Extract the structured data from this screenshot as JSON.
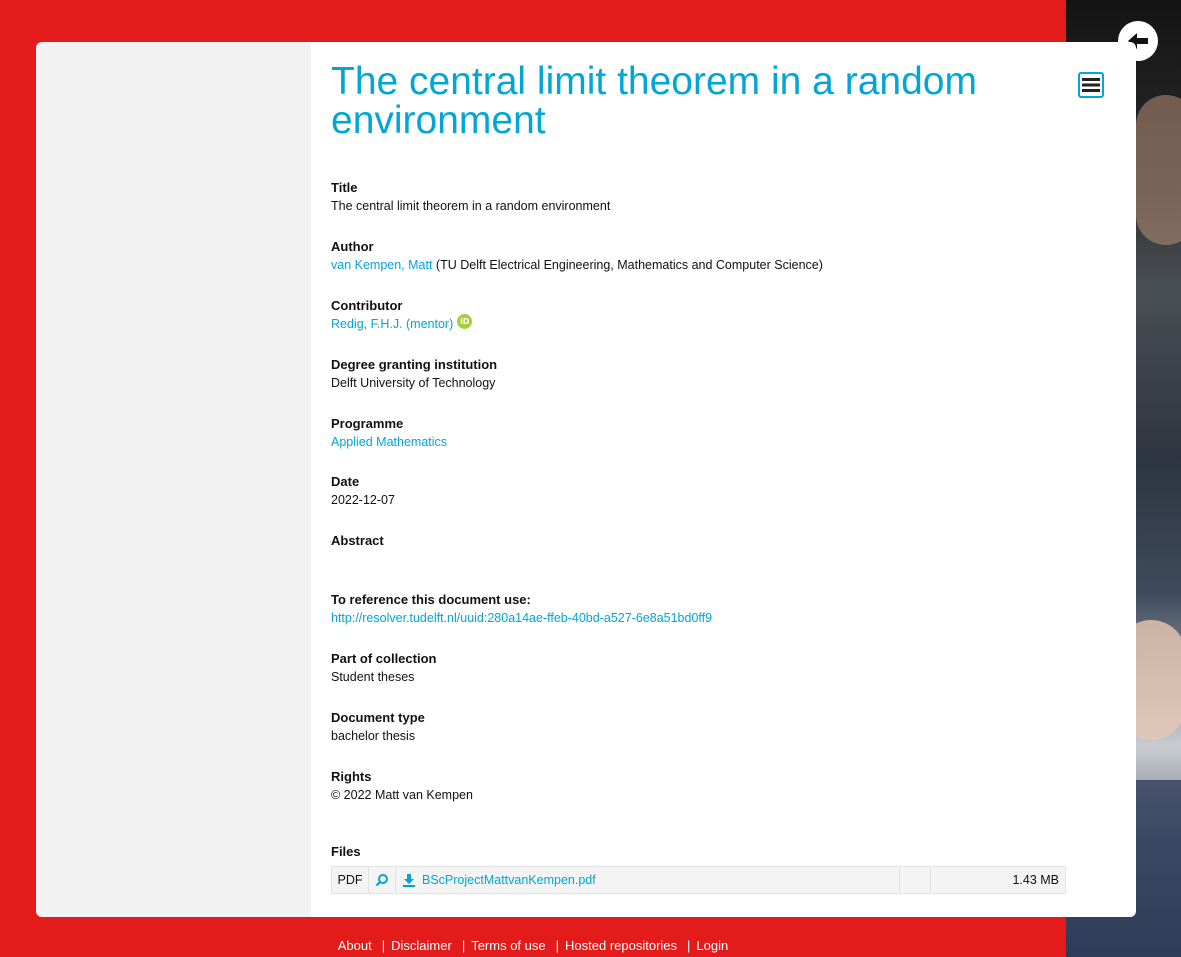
{
  "page": {
    "title": "The central limit theorem in a random environment"
  },
  "fields": [
    {
      "label": "Title",
      "value": "The central limit theorem in a random environment"
    },
    {
      "label": "Author",
      "link": "van Kempen, Matt",
      "suffix": " (TU Delft Electrical Engineering, Mathematics and Computer Science)"
    },
    {
      "label": "Contributor",
      "link": "Redig, F.H.J. (mentor)",
      "orcid": "iD"
    },
    {
      "label": "Degree granting institution",
      "value": "Delft University of Technology"
    },
    {
      "label": "Programme",
      "link": "Applied Mathematics"
    },
    {
      "label": "Date",
      "value": "2022-12-07"
    },
    {
      "label": "Abstract",
      "value": ""
    },
    {
      "label": "To reference this document use:",
      "link": "http://resolver.tudelft.nl/uuid:280a14ae-ffeb-40bd-a527-6e8a51bd0ff9"
    },
    {
      "label": "Part of collection",
      "value": "Student theses"
    },
    {
      "label": "Document type",
      "value": "bachelor thesis"
    },
    {
      "label": "Rights",
      "value": "© 2022 Matt van Kempen"
    }
  ],
  "files": {
    "label": "Files",
    "rows": [
      {
        "type": "PDF",
        "name": "BScProjectMattvanKempen.pdf",
        "size": "1.43 MB"
      }
    ]
  },
  "footer": {
    "links": [
      "About",
      "Disclaimer",
      "Terms of use",
      "Hosted repositories",
      "Login"
    ]
  },
  "colors": {
    "accent": "#00a6d6",
    "background": "#e31b1b",
    "orcid": "#a6ce39"
  },
  "icons": {
    "back": "arrow-left-icon",
    "menu": "hamburger-menu-icon",
    "view": "magnifier-icon",
    "download": "download-icon"
  }
}
